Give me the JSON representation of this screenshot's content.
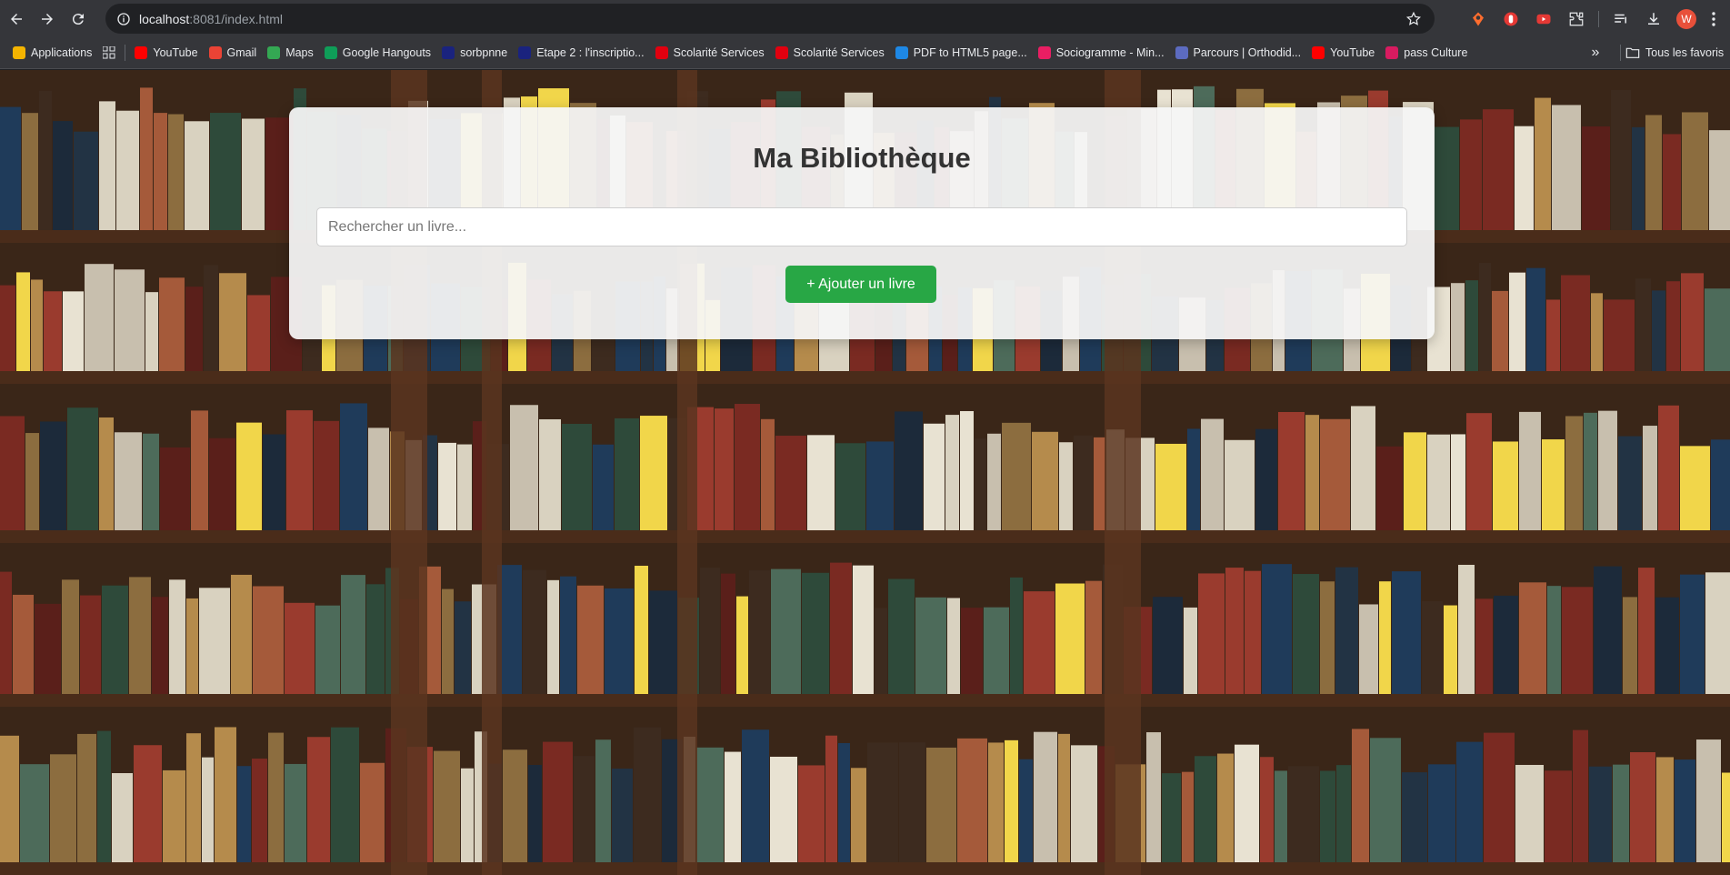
{
  "browser": {
    "url_host": "localhost",
    "url_rest": ":8081/index.html",
    "bookmarks": [
      {
        "label": "Applications",
        "icon": "apps-grid-icon",
        "color": "#f4b400"
      },
      {
        "label": "YouTube",
        "icon": "youtube-icon",
        "color": "#ff0000"
      },
      {
        "label": "Gmail",
        "icon": "gmail-icon",
        "color": "#ea4335"
      },
      {
        "label": "Maps",
        "icon": "maps-icon",
        "color": "#34a853"
      },
      {
        "label": "Google Hangouts",
        "icon": "hangouts-icon",
        "color": "#0f9d58"
      },
      {
        "label": "sorbpnne",
        "icon": "sorbonne-icon",
        "color": "#1a237e"
      },
      {
        "label": "Etape 2 : l'inscriptio...",
        "icon": "etape-icon",
        "color": "#1a237e"
      },
      {
        "label": "Scolarité Services",
        "icon": "marianne-icon",
        "color": "#e1000f"
      },
      {
        "label": "Scolarité Services",
        "icon": "marianne-icon",
        "color": "#e1000f"
      },
      {
        "label": "PDF to HTML5 page...",
        "icon": "pdf-icon",
        "color": "#1e88e5"
      },
      {
        "label": "Sociogramme - Min...",
        "icon": "socio-icon",
        "color": "#e91e63"
      },
      {
        "label": "Parcours | Orthodid...",
        "icon": "parcours-icon",
        "color": "#5c6bc0"
      },
      {
        "label": "YouTube",
        "icon": "youtube-icon",
        "color": "#ff0000"
      },
      {
        "label": "pass Culture",
        "icon": "pass-culture-icon",
        "color": "#d81b60"
      }
    ],
    "all_bookmarks_label": "Tous les favoris",
    "more_label": "»",
    "profile_initial": "W"
  },
  "page": {
    "title": "Ma Bibliothèque",
    "search_placeholder": "Rechercher un livre...",
    "add_button_label": "+ Ajouter un livre"
  },
  "colors": {
    "accent_green": "#28a745",
    "panel_bg": "#f5f5f5",
    "title_text": "#333333"
  }
}
